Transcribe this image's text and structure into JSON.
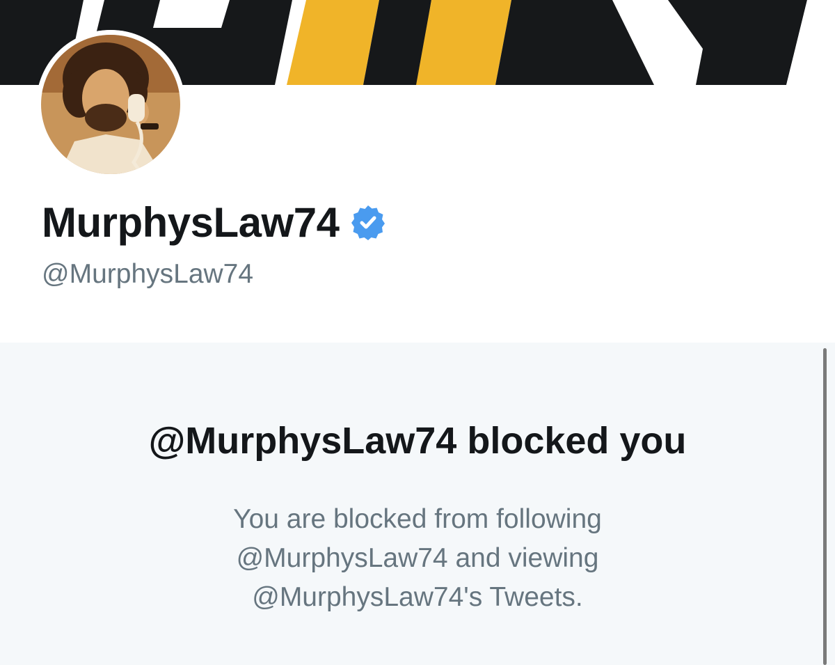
{
  "profile": {
    "display_name": "MurphysLaw74",
    "handle": "@MurphysLaw74",
    "verified": true,
    "avatar_icon": "profile-photo-man-on-phone",
    "banner_icon": "banner-graphic"
  },
  "blocked": {
    "title": "@MurphysLaw74 blocked you",
    "description_lines": [
      "You are blocked from following",
      "@MurphysLaw74 and viewing",
      "@MurphysLaw74's Tweets."
    ]
  },
  "colors": {
    "text_primary": "#14171a",
    "text_secondary": "#66757f",
    "verified_blue": "#4a9bef",
    "panel_background": "#f5f8fa",
    "banner_dark": "#16181a",
    "banner_yellow": "#f0b429"
  }
}
